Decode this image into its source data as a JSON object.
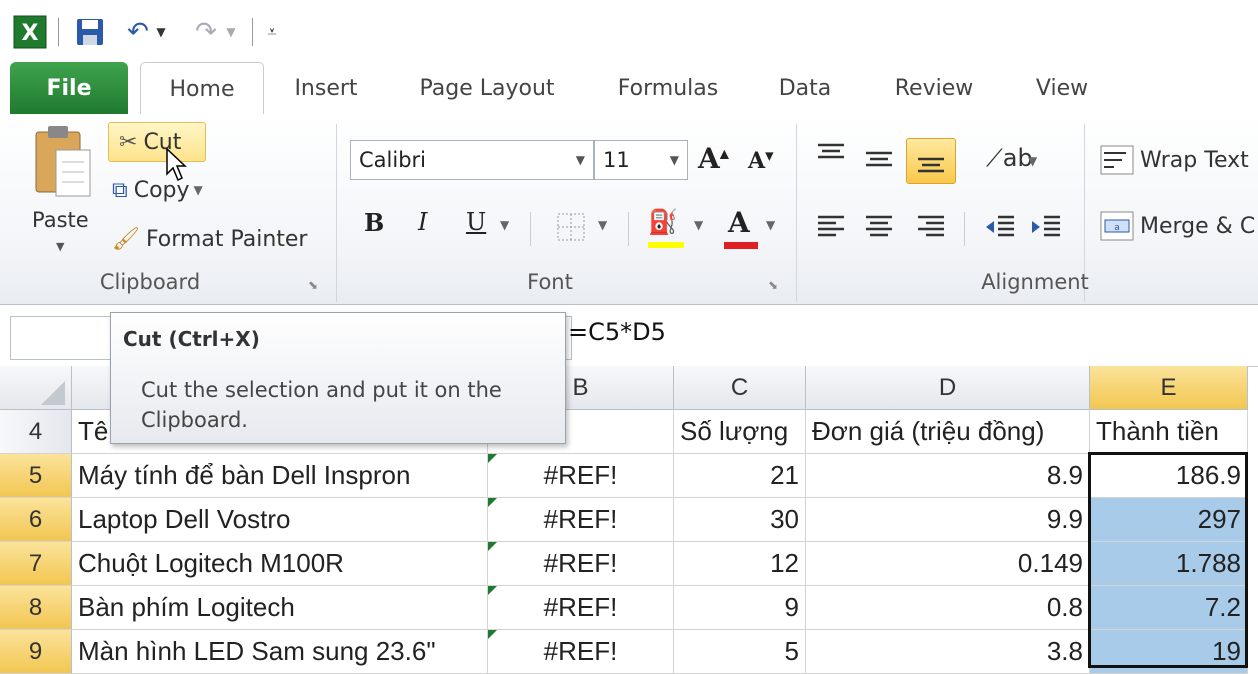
{
  "qat": {
    "excel_icon": "excel-icon",
    "save_icon": "save-icon",
    "undo_icon": "undo-icon",
    "redo_icon": "redo-icon",
    "customize_icon": "customize-qat-icon"
  },
  "tabs": [
    {
      "label": "File"
    },
    {
      "label": "Home"
    },
    {
      "label": "Insert"
    },
    {
      "label": "Page Layout"
    },
    {
      "label": "Formulas"
    },
    {
      "label": "Data"
    },
    {
      "label": "Review"
    },
    {
      "label": "View"
    }
  ],
  "clipboard": {
    "paste": "Paste",
    "cut": "Cut",
    "copy": "Copy",
    "format_painter": "Format Painter",
    "group": "Clipboard"
  },
  "font": {
    "name": "Calibri",
    "size": "11",
    "grow": "A",
    "shrink": "A",
    "bold": "B",
    "italic": "I",
    "underline": "U",
    "color_letter": "A",
    "group": "Font"
  },
  "alignment": {
    "wrap_text": "Wrap Text",
    "merge": "Merge & C",
    "group": "Alignment"
  },
  "formula": "=C5*D5",
  "tooltip": {
    "title": "Cut (Ctrl+X)",
    "body": "Cut the selection and put it on the Clipboard."
  },
  "columns": [
    "B",
    "C",
    "D",
    "E"
  ],
  "header_row": {
    "num": "4",
    "a": "Tê",
    "c": "Số lượng",
    "d": "Đơn giá (triệu đồng)",
    "e": "Thành tiền"
  },
  "rows": [
    {
      "num": "5",
      "a": "Máy tính để bàn Dell Inspron",
      "b": "#REF!",
      "c": "21",
      "d": "8.9",
      "e": "186.9"
    },
    {
      "num": "6",
      "a": "Laptop Dell Vostro",
      "b": "#REF!",
      "c": "30",
      "d": "9.9",
      "e": "297"
    },
    {
      "num": "7",
      "a": "Chuột Logitech M100R",
      "b": "#REF!",
      "c": "12",
      "d": "0.149",
      "e": "1.788"
    },
    {
      "num": "8",
      "a": "Bàn phím Logitech",
      "b": "#REF!",
      "c": "9",
      "d": "0.8",
      "e": "7.2"
    },
    {
      "num": "9",
      "a": "Màn hình LED Sam sung 23.6\"",
      "b": "#REF!",
      "c": "5",
      "d": "3.8",
      "e": "19"
    }
  ],
  "colors": {
    "file_tab": "#1f7a2e",
    "selection_fill": "#a8cbea",
    "header_highlight": "#f2c651",
    "font_color_bar": "#e02020",
    "highlight_bar": "#ffff00"
  }
}
